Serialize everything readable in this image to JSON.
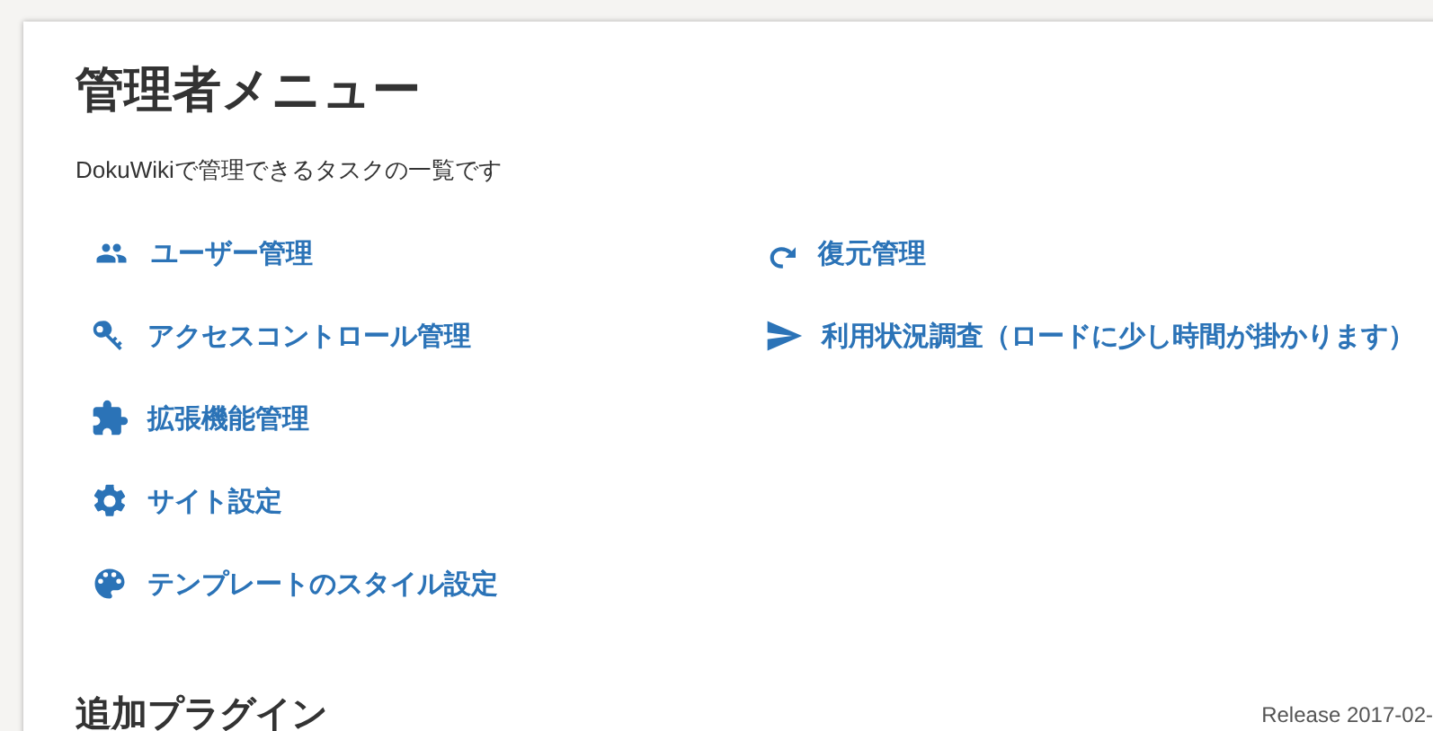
{
  "title": "管理者メニュー",
  "description": "DokuWikiで管理できるタスクの一覧です",
  "admin_menu": {
    "left": [
      {
        "label": "ユーザー管理"
      },
      {
        "label": "アクセスコントロール管理"
      },
      {
        "label": "拡張機能管理"
      },
      {
        "label": "サイト設定"
      },
      {
        "label": "テンプレートのスタイル設定"
      }
    ],
    "right": [
      {
        "label": "復元管理"
      },
      {
        "label": "利用状況調査（ロードに少し時間が掛かります）"
      }
    ]
  },
  "plugins_heading": "追加プラグイン",
  "release": "Release 2017-02-"
}
